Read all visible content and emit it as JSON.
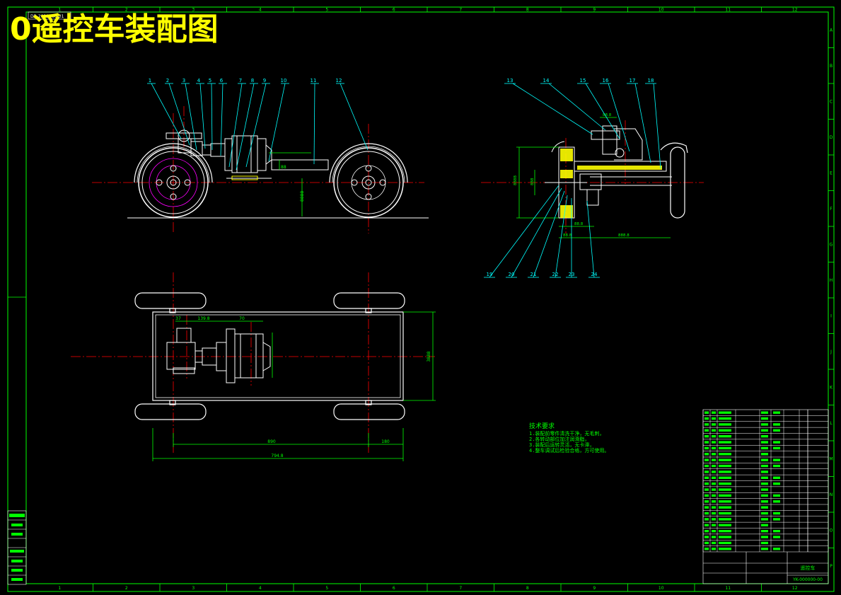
{
  "title": "0遥控车装配图",
  "small_label": "DB-2021000-01",
  "colors": {
    "background": "#000000",
    "frame": "#00ff00",
    "outline": "#ffffff",
    "centerline": "#ff0000",
    "leader": "#00ffff",
    "dimension": "#00ff00",
    "hatch": "#ffff00",
    "hidden": "#ff00ff",
    "title": "#ffff00"
  },
  "grid": {
    "columns": [
      "1",
      "2",
      "3",
      "4",
      "5",
      "6",
      "7",
      "8",
      "9",
      "10",
      "11",
      "12"
    ],
    "rows": [
      "A",
      "B",
      "C",
      "D",
      "E",
      "F",
      "G",
      "H",
      "I",
      "J",
      "K",
      "L",
      "M",
      "N",
      "O",
      "P"
    ]
  },
  "side_view_callouts": [
    "1",
    "2",
    "3",
    "4",
    "5",
    "6",
    "7",
    "8",
    "9",
    "10",
    "11",
    "12"
  ],
  "end_view_top_callouts": [
    "13",
    "14",
    "15",
    "16",
    "17",
    "18"
  ],
  "end_view_bottom_callouts": [
    "19",
    "20",
    "21",
    "22",
    "23",
    "24"
  ],
  "plan_view_dims": [
    "37",
    "139.8",
    "70",
    "890",
    "180",
    "794.8",
    "3888"
  ],
  "tech_notes": {
    "heading": "技术要求",
    "lines": [
      "1.装配前零件清洗干净，无毛刺，",
      "2.各转动部位加注润滑脂，",
      "3.装配后运转灵活，无卡滞，",
      "4.整车调试后检验合格，方可使用。"
    ]
  },
  "title_block": {
    "drawing_name": "遥控车",
    "drawing_code": "YK-000000-00",
    "bom_row_count": 24
  }
}
